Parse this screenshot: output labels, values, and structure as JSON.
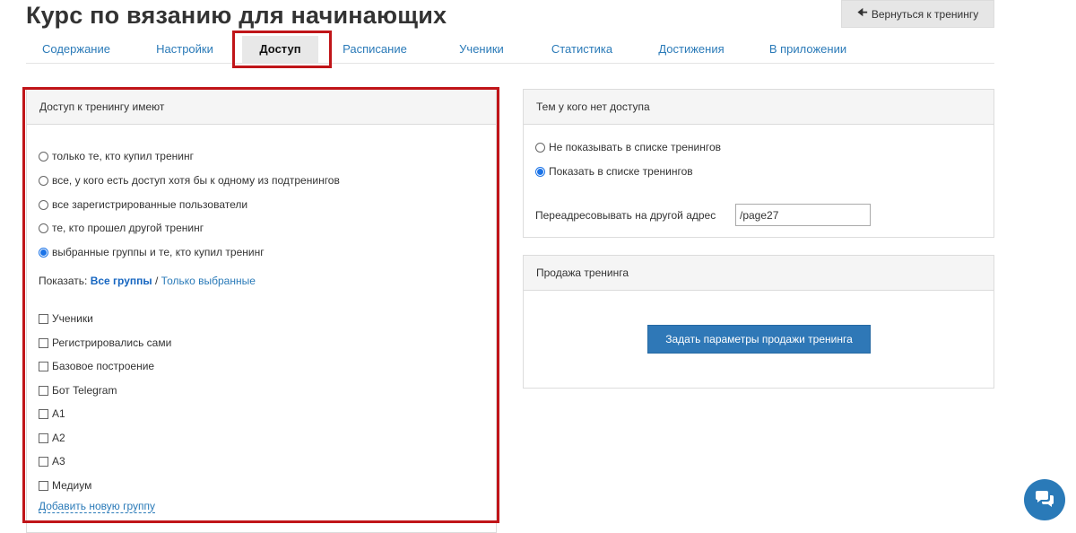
{
  "header": {
    "title": "Курс по вязанию для начинающих",
    "back_label": "Вернуться к тренингу",
    "back_icon": "arrow-left-icon"
  },
  "tabs": [
    {
      "label": "Содержание",
      "active": false
    },
    {
      "label": "Настройки",
      "active": false
    },
    {
      "label": "Доступ",
      "active": true
    },
    {
      "label": "Расписание",
      "active": false
    },
    {
      "label": "Ученики",
      "active": false
    },
    {
      "label": "Статистика",
      "active": false
    },
    {
      "label": "Достижения",
      "active": false
    },
    {
      "label": "В приложении",
      "active": false
    }
  ],
  "access_panel": {
    "title": "Доступ к тренингу имеют",
    "options": [
      {
        "label": "только те, кто купил тренинг",
        "checked": false
      },
      {
        "label": "все, у кого есть доступ хотя бы к одному из подтренингов",
        "checked": false
      },
      {
        "label": "все зарегистрированные пользователи",
        "checked": false
      },
      {
        "label": "те, кто прошел другой тренинг",
        "checked": false
      },
      {
        "label": "выбранные группы и те, кто купил тренинг",
        "checked": true
      }
    ],
    "show_label": "Показать:",
    "show_all": "Все группы",
    "show_separator": "/",
    "show_selected": "Только выбранные",
    "groups": [
      {
        "label": "Ученики",
        "checked": false
      },
      {
        "label": "Регистрировались сами",
        "checked": false
      },
      {
        "label": "Базовое построение",
        "checked": false
      },
      {
        "label": "Бот Telegram",
        "checked": false
      },
      {
        "label": "А1",
        "checked": false
      },
      {
        "label": "А2",
        "checked": false
      },
      {
        "label": "А3",
        "checked": false
      },
      {
        "label": "Медиум",
        "checked": false
      }
    ],
    "add_group": "Добавить новую группу"
  },
  "no_access_panel": {
    "title": "Тем у кого нет доступа",
    "options": [
      {
        "label": "Не показывать в списке тренингов",
        "checked": false
      },
      {
        "label": "Показать в списке тренингов",
        "checked": true
      }
    ],
    "redirect_label": "Переадресовывать на другой адрес",
    "redirect_value": "/page27"
  },
  "sale_panel": {
    "title": "Продажа тренинга",
    "button_label": "Задать параметры продажи тренинга"
  },
  "chat": {
    "icon": "chat-bubbles-icon"
  },
  "colors": {
    "accent": "#2f78b7",
    "link": "#2a7ab8",
    "highlight": "#c01519",
    "radio_on": "#1a73e8"
  }
}
